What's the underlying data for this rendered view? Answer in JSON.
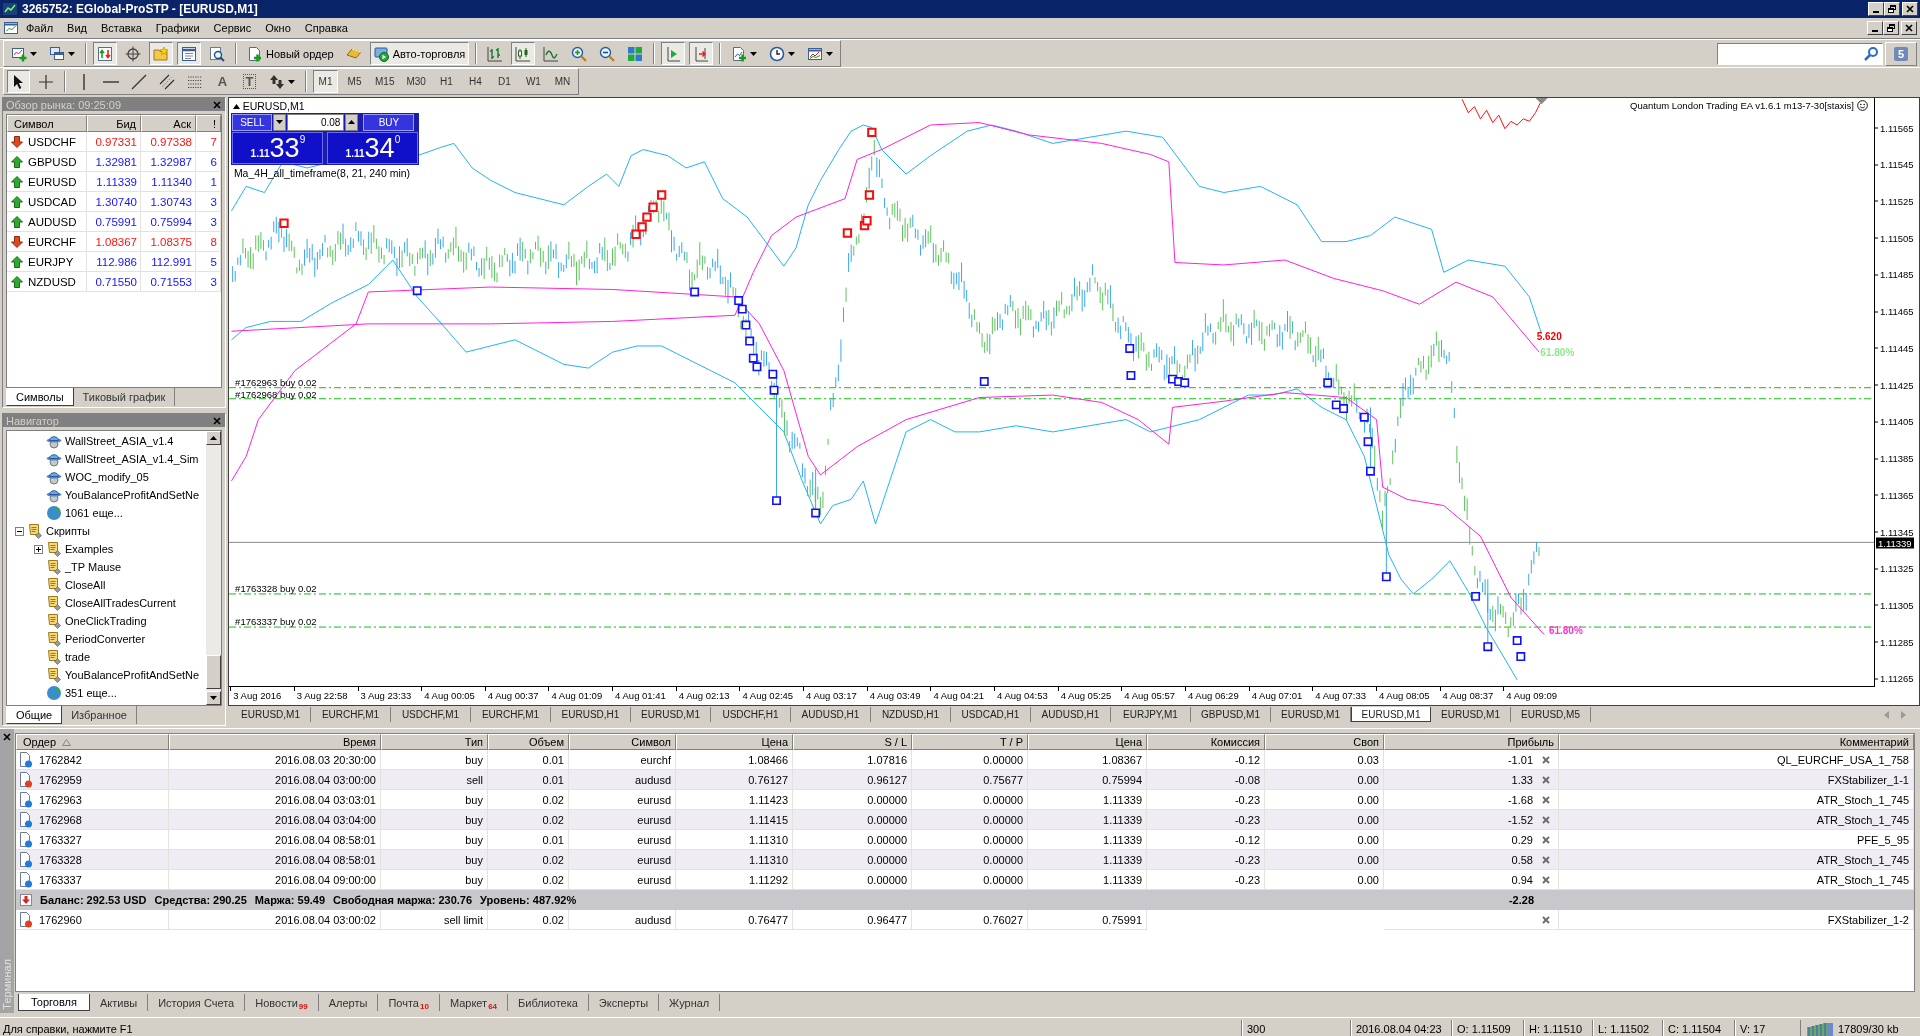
{
  "window": {
    "title": "3265752: EGlobal-ProSTP - [EURUSD,M1]"
  },
  "menu": [
    "Файл",
    "Вид",
    "Вставка",
    "Графики",
    "Сервис",
    "Окно",
    "Справка"
  ],
  "toolbar_main": {
    "groups": [
      [
        {
          "kind": "newchart",
          "pressed": false
        },
        {
          "kind": "profiles",
          "pressed": false
        }
      ],
      [
        {
          "kind": "marketwatch",
          "pressed": true
        },
        {
          "kind": "datawindow",
          "pressed": false
        },
        {
          "kind": "navigator",
          "pressed": true
        },
        {
          "kind": "terminal",
          "pressed": true
        },
        {
          "kind": "tester",
          "pressed": false
        }
      ],
      [
        {
          "kind": "neworder",
          "label": "Новый ордер",
          "pressed": false
        },
        {
          "kind": "gold",
          "pressed": false
        },
        {
          "kind": "autotrading",
          "label": "Авто-торговля",
          "pressed": true
        }
      ],
      [
        {
          "kind": "bars",
          "pressed": false
        },
        {
          "kind": "candles",
          "pressed": true
        },
        {
          "kind": "line",
          "pressed": false
        },
        {
          "kind": "zoomin",
          "pressed": false
        },
        {
          "kind": "zoomout",
          "pressed": false
        },
        {
          "kind": "tile",
          "pressed": false
        }
      ],
      [
        {
          "kind": "autoscroll",
          "pressed": true
        },
        {
          "kind": "shift",
          "pressed": true
        }
      ],
      [
        {
          "kind": "indicators",
          "pressed": false
        },
        {
          "kind": "periods",
          "pressed": false
        },
        {
          "kind": "templates",
          "pressed": false
        }
      ]
    ],
    "chat_count": "5"
  },
  "toolbar_tools": {
    "groups": [
      [
        {
          "kind": "cursor",
          "pressed": true
        },
        {
          "kind": "crosshair",
          "pressed": false
        }
      ],
      [
        {
          "kind": "vline",
          "pressed": false
        },
        {
          "kind": "hline",
          "pressed": false
        },
        {
          "kind": "trend",
          "pressed": false
        },
        {
          "kind": "channel",
          "pressed": false
        },
        {
          "kind": "fibo",
          "pressed": false
        },
        {
          "kind": "text",
          "label": "A",
          "pressed": false
        },
        {
          "kind": "label",
          "label": "T",
          "pressed": false
        },
        {
          "kind": "arrows",
          "pressed": false
        }
      ]
    ],
    "timeframes": [
      {
        "label": "M1",
        "selected": true
      },
      {
        "label": "M5",
        "selected": false
      },
      {
        "label": "M15",
        "selected": false
      },
      {
        "label": "M30",
        "selected": false
      },
      {
        "label": "H1",
        "selected": false
      },
      {
        "label": "H4",
        "selected": false
      },
      {
        "label": "D1",
        "selected": false
      },
      {
        "label": "W1",
        "selected": false
      },
      {
        "label": "MN",
        "selected": false
      }
    ]
  },
  "market_watch": {
    "title": "Обзор рынка: 09:25:09",
    "columns": [
      "Символ",
      "Бид",
      "Аск",
      "!"
    ],
    "rows": [
      {
        "symbol": "USDCHF",
        "bid": "0.97331",
        "ask": "0.97338",
        "spread": "7",
        "rising": false
      },
      {
        "symbol": "GBPUSD",
        "bid": "1.32981",
        "ask": "1.32987",
        "spread": "6",
        "rising": true
      },
      {
        "symbol": "EURUSD",
        "bid": "1.11339",
        "ask": "1.11340",
        "spread": "1",
        "rising": true
      },
      {
        "symbol": "USDCAD",
        "bid": "1.30740",
        "ask": "1.30743",
        "spread": "3",
        "rising": true
      },
      {
        "symbol": "AUDUSD",
        "bid": "0.75991",
        "ask": "0.75994",
        "spread": "3",
        "rising": true
      },
      {
        "symbol": "EURCHF",
        "bid": "1.08367",
        "ask": "1.08375",
        "spread": "8",
        "rising": false
      },
      {
        "symbol": "EURJPY",
        "bid": "112.986",
        "ask": "112.991",
        "spread": "5",
        "rising": true
      },
      {
        "symbol": "NZDUSD",
        "bid": "0.71550",
        "ask": "0.71553",
        "spread": "3",
        "rising": true
      }
    ],
    "tabs": [
      {
        "label": "Символы",
        "selected": true
      },
      {
        "label": "Тиковый график",
        "selected": false
      }
    ]
  },
  "navigator": {
    "title": "Навигатор",
    "tree": [
      {
        "children": [
          {
            "label": "WallStreet_ASIA_v1.4",
            "kind": "expert"
          },
          {
            "label": "WallStreet_ASIA_v1.4_Sim",
            "kind": "expert"
          },
          {
            "label": "WOC_modify_05",
            "kind": "expert"
          },
          {
            "label": "YouBalanceProfitAndSetNe",
            "kind": "expert"
          },
          {
            "label": "1061 еще...",
            "kind": "more"
          }
        ]
      },
      {
        "label": "Скрипты",
        "kind": "script",
        "expanded": true,
        "children": [
          {
            "label": "Examples",
            "kind": "script",
            "expanded": false
          },
          {
            "label": "_TP Mause",
            "kind": "script"
          },
          {
            "label": "CloseAll",
            "kind": "script"
          },
          {
            "label": "CloseAllTradesCurrent",
            "kind": "script"
          },
          {
            "label": "OneClickTrading",
            "kind": "script"
          },
          {
            "label": "PeriodConverter",
            "kind": "script"
          },
          {
            "label": "trade",
            "kind": "script"
          },
          {
            "label": "YouBalanceProfitAndSetNe",
            "kind": "script"
          },
          {
            "label": "351 еще...",
            "kind": "more"
          }
        ]
      }
    ],
    "tabs": [
      {
        "label": "Общие",
        "selected": true
      },
      {
        "label": "Избранное",
        "selected": false
      }
    ]
  },
  "chart": {
    "symbol_label": "EURUSD,M1",
    "one_click": {
      "sell_label": "SELL",
      "buy_label": "BUY",
      "volume": "0.08",
      "sell_price": {
        "prefix": "1.11",
        "pips": "33",
        "point": "9"
      },
      "buy_price": {
        "prefix": "1.11",
        "pips": "34",
        "point": "0"
      }
    },
    "indicator_label": "Ma_4H_all_timeframe(8, 21, 240 min)",
    "expert_label": "Quantum London Trading EA v1.6.1 m13-7-30[staxis]",
    "order_labels": [
      "#1762963 buy 0.02",
      "#1762968 buy 0.02",
      "#1763328 buy 0.02",
      "#1763337 buy 0.02"
    ],
    "level_labels": [
      {
        "text": "5.620",
        "color": "#ff0000"
      },
      {
        "text": "61.80%",
        "color": "#90e890"
      },
      {
        "text": "61.80%",
        "color": "#ff33cc"
      }
    ],
    "price_axis": [
      "1.11565",
      "1.11545",
      "1.11525",
      "1.11505",
      "1.11485",
      "1.11465",
      "1.11445",
      "1.11425",
      "1.11405",
      "1.11385",
      "1.11365",
      "1.11345",
      "1.11325",
      "1.11305",
      "1.11285",
      "1.11265"
    ],
    "current_price": "1.11339",
    "time_axis": [
      "3 Aug 2016",
      "3 Aug 22:58",
      "3 Aug 23:33",
      "4 Aug 00:05",
      "4 Aug 00:37",
      "4 Aug 01:09",
      "4 Aug 01:41",
      "4 Aug 02:13",
      "4 Aug 02:45",
      "4 Aug 03:17",
      "4 Aug 03:49",
      "4 Aug 04:21",
      "4 Aug 04:53",
      "4 Aug 05:25",
      "4 Aug 05:57",
      "4 Aug 06:29",
      "4 Aug 07:01",
      "4 Aug 07:33",
      "4 Aug 08:05",
      "4 Aug 08:37",
      "4 Aug 09:09"
    ]
  },
  "chart_tabs": [
    {
      "label": "EURUSD,M1",
      "selected": false
    },
    {
      "label": "EURCHF,M1",
      "selected": false
    },
    {
      "label": "USDCHF,M1",
      "selected": false
    },
    {
      "label": "EURCHF,M1",
      "selected": false
    },
    {
      "label": "EURUSD,H1",
      "selected": false
    },
    {
      "label": "EURUSD,M1",
      "selected": false
    },
    {
      "label": "USDCHF,H1",
      "selected": false
    },
    {
      "label": "AUDUSD,H1",
      "selected": false
    },
    {
      "label": "NZDUSD,H1",
      "selected": false
    },
    {
      "label": "USDCAD,H1",
      "selected": false
    },
    {
      "label": "AUDUSD,H1",
      "selected": false
    },
    {
      "label": "EURJPY,M1",
      "selected": false
    },
    {
      "label": "GBPUSD,M1",
      "selected": false
    },
    {
      "label": "EURUSD,M1",
      "selected": false
    },
    {
      "label": "EURUSD,M1",
      "selected": true
    },
    {
      "label": "EURUSD,M1",
      "selected": false
    },
    {
      "label": "EURUSD,M5",
      "selected": false
    }
  ],
  "terminal": {
    "title": "Терминал",
    "columns": [
      "Ордер",
      "Время",
      "Тип",
      "Объем",
      "Символ",
      "Цена",
      "S / L",
      "T / P",
      "Цена",
      "Комиссия",
      "Своп",
      "Прибыль",
      "Комментарий"
    ],
    "orders": [
      {
        "kind": "buy",
        "order": "1762842",
        "time": "2016.08.03 20:30:00",
        "type": "buy",
        "volume": "0.01",
        "symbol": "eurchf",
        "price": "1.08466",
        "sl": "1.07816",
        "tp": "0.00000",
        "current": "1.08367",
        "commission": "-0.12",
        "swap": "0.03",
        "profit": "-1.01",
        "comment": "QL_EURCHF_USA_1_758"
      },
      {
        "kind": "sell",
        "order": "1762959",
        "time": "2016.08.04 03:00:00",
        "type": "sell",
        "volume": "0.01",
        "symbol": "audusd",
        "price": "0.76127",
        "sl": "0.96127",
        "tp": "0.75677",
        "current": "0.75994",
        "commission": "-0.08",
        "swap": "0.00",
        "profit": "1.33",
        "comment": "FXStabilizer_1-1"
      },
      {
        "kind": "buy",
        "order": "1762963",
        "time": "2016.08.04 03:03:01",
        "type": "buy",
        "volume": "0.02",
        "symbol": "eurusd",
        "price": "1.11423",
        "sl": "0.00000",
        "tp": "0.00000",
        "current": "1.11339",
        "commission": "-0.23",
        "swap": "0.00",
        "profit": "-1.68",
        "comment": "ATR_Stoch_1_745"
      },
      {
        "kind": "buy",
        "order": "1762968",
        "time": "2016.08.04 03:04:00",
        "type": "buy",
        "volume": "0.02",
        "symbol": "eurusd",
        "price": "1.11415",
        "sl": "0.00000",
        "tp": "0.00000",
        "current": "1.11339",
        "commission": "-0.23",
        "swap": "0.00",
        "profit": "-1.52",
        "comment": "ATR_Stoch_1_745"
      },
      {
        "kind": "buy",
        "order": "1763327",
        "time": "2016.08.04 08:58:01",
        "type": "buy",
        "volume": "0.01",
        "symbol": "eurusd",
        "price": "1.11310",
        "sl": "0.00000",
        "tp": "0.00000",
        "current": "1.11339",
        "commission": "-0.12",
        "swap": "0.00",
        "profit": "0.29",
        "comment": "PFE_5_95"
      },
      {
        "kind": "buy",
        "order": "1763328",
        "time": "2016.08.04 08:58:01",
        "type": "buy",
        "volume": "0.02",
        "symbol": "eurusd",
        "price": "1.11310",
        "sl": "0.00000",
        "tp": "0.00000",
        "current": "1.11339",
        "commission": "-0.23",
        "swap": "0.00",
        "profit": "0.58",
        "comment": "ATR_Stoch_1_745"
      },
      {
        "kind": "buy",
        "order": "1763337",
        "time": "2016.08.04 09:00:00",
        "type": "buy",
        "volume": "0.02",
        "symbol": "eurusd",
        "price": "1.11292",
        "sl": "0.00000",
        "tp": "0.00000",
        "current": "1.11339",
        "commission": "-0.23",
        "swap": "0.00",
        "profit": "0.94",
        "comment": "ATR_Stoch_1_745"
      }
    ],
    "summary": {
      "parts": [
        "Баланс: 292.53 USD",
        "Средства: 290.25",
        "Маржа: 59.49",
        "Свободная маржа: 230.76",
        "Уровень: 487.92%"
      ],
      "profit": "-2.28"
    },
    "pending": [
      {
        "kind": "sell",
        "order": "1762960",
        "time": "2016.08.04 03:00:02",
        "type": "sell limit",
        "volume": "0.02",
        "symbol": "audusd",
        "price": "0.76477",
        "sl": "0.96477",
        "tp": "0.76027",
        "current": "0.75991",
        "comment": "FXStabilizer_1-2"
      }
    ],
    "tabs": [
      {
        "label": "Торговля",
        "selected": true
      },
      {
        "label": "Активы",
        "selected": false
      },
      {
        "label": "История Счета",
        "selected": false
      },
      {
        "label": "Новости",
        "badge": "99",
        "selected": false
      },
      {
        "label": "Алерты",
        "selected": false
      },
      {
        "label": "Почта",
        "badge": "10",
        "selected": false
      },
      {
        "label": "Маркет",
        "badge": "64",
        "selected": false
      },
      {
        "label": "Библиотека",
        "selected": false
      },
      {
        "label": "Эксперты",
        "selected": false
      },
      {
        "label": "Журнал",
        "selected": false
      }
    ]
  },
  "status_bar": {
    "help": "Для справки, нажмите F1",
    "cells": [
      "300",
      "2016.08.04 04:23",
      "O: 1.11509",
      "H: 1.11510",
      "L: 1.11502",
      "C: 1.11504",
      "V: 17"
    ],
    "connection": "17809/30 kb"
  }
}
